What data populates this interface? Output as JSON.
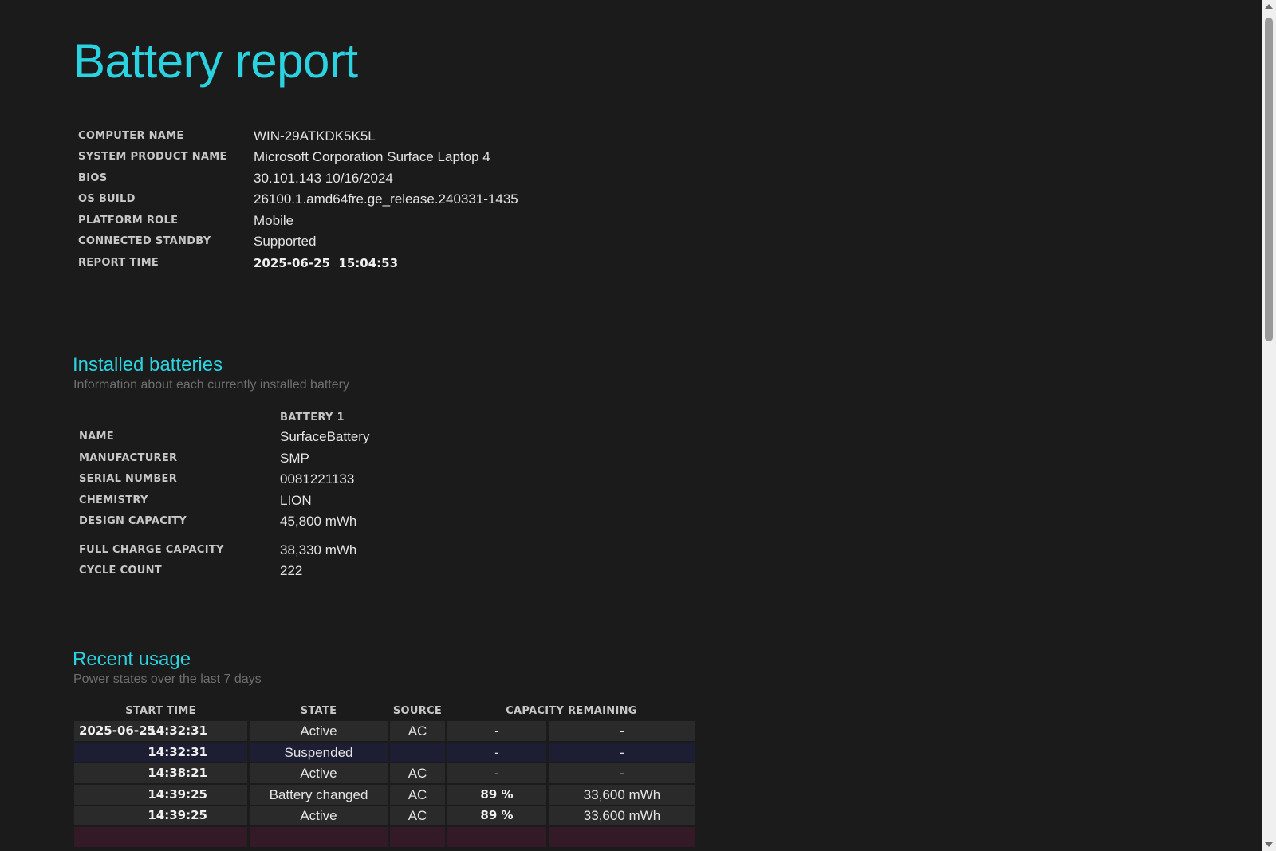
{
  "header": {
    "title": "Battery report"
  },
  "system_info": [
    {
      "label": "COMPUTER NAME",
      "value": "WIN-29ATKDK5K5L"
    },
    {
      "label": "SYSTEM PRODUCT NAME",
      "value": "Microsoft Corporation Surface Laptop 4"
    },
    {
      "label": "BIOS",
      "value": "30.101.143 10/16/2024"
    },
    {
      "label": "OS BUILD",
      "value": "26100.1.amd64fre.ge_release.240331-1435"
    },
    {
      "label": "PLATFORM ROLE",
      "value": "Mobile"
    },
    {
      "label": "CONNECTED STANDBY",
      "value": "Supported"
    },
    {
      "label": "REPORT TIME",
      "value": "2025-06-25  15:04:53"
    }
  ],
  "installed_batteries": {
    "title": "Installed batteries",
    "subtitle": "Information about each currently installed battery",
    "column_header": "BATTERY 1",
    "rows": [
      {
        "label": "NAME",
        "value": "SurfaceBattery"
      },
      {
        "label": "MANUFACTURER",
        "value": "SMP"
      },
      {
        "label": "SERIAL NUMBER",
        "value": "0081221133"
      },
      {
        "label": "CHEMISTRY",
        "value": "LION"
      },
      {
        "label": "DESIGN CAPACITY",
        "value": "45,800 mWh"
      },
      {
        "label": "FULL CHARGE CAPACITY",
        "value": "38,330 mWh"
      },
      {
        "label": "CYCLE COUNT",
        "value": "222"
      }
    ]
  },
  "recent_usage": {
    "title": "Recent usage",
    "subtitle": "Power states over the last 7 days",
    "headers": {
      "start_time": "START TIME",
      "state": "STATE",
      "source": "SOURCE",
      "capacity_remaining": "CAPACITY REMAINING"
    },
    "rows": [
      {
        "date": "2025-06-25",
        "time": "14:32:31",
        "state": "Active",
        "source": "AC",
        "percent": "-",
        "mwh": "-"
      },
      {
        "date": "",
        "time": "14:32:31",
        "state": "Suspended",
        "source": "",
        "percent": "-",
        "mwh": "-"
      },
      {
        "date": "",
        "time": "14:38:21",
        "state": "Active",
        "source": "AC",
        "percent": "-",
        "mwh": "-"
      },
      {
        "date": "",
        "time": "14:39:25",
        "state": "Battery changed",
        "source": "AC",
        "percent": "89 %",
        "mwh": "33,600 mWh"
      },
      {
        "date": "",
        "time": "14:39:25",
        "state": "Active",
        "source": "AC",
        "percent": "89 %",
        "mwh": "33,600 mWh"
      }
    ]
  }
}
